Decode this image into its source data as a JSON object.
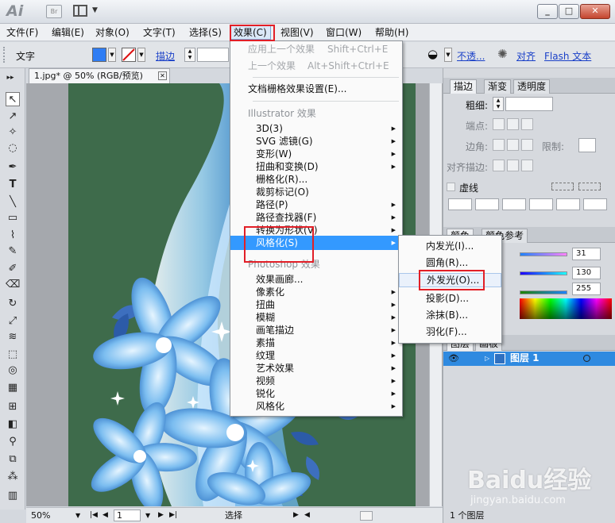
{
  "app": {
    "logo": "Ai",
    "bridge_label": "Br",
    "window_buttons": [
      "_",
      "□",
      "✕"
    ]
  },
  "menubar": {
    "items": [
      "文件(F)",
      "编辑(E)",
      "对象(O)",
      "文字(T)",
      "选择(S)",
      "效果(C)",
      "视图(V)",
      "窗口(W)",
      "帮助(H)"
    ],
    "active_index": 5
  },
  "controlbar": {
    "tool_label": "文字",
    "fill_color": "#2f7df4",
    "stroke_label": "描边",
    "opacity_label": "不透...",
    "align_label": "对齐",
    "flash_label": "Flash 文本"
  },
  "document": {
    "tab_title": "1.jpg* @ 50% (RGB/预览)",
    "artboard_color": "#3e6b4b"
  },
  "statusbar": {
    "zoom": "50%",
    "page": "1",
    "tool": "选择"
  },
  "effects_menu": {
    "apply_last": "应用上一个效果",
    "apply_last_shortcut": "Shift+Ctrl+E",
    "last": "上一个效果",
    "last_shortcut": "Alt+Shift+Ctrl+E",
    "raster_settings": "文档栅格效果设置(E)...",
    "illustrator_header": "Illustrator 效果",
    "illustrator_items": [
      "3D(3)",
      "SVG 滤镜(G)",
      "变形(W)",
      "扭曲和变换(D)",
      "栅格化(R)...",
      "裁剪标记(O)",
      "路径(P)",
      "路径查找器(F)",
      "转换为形状(V)",
      "风格化(S)"
    ],
    "photoshop_header": "Photoshop 效果",
    "photoshop_items": [
      "效果画廊...",
      "像素化",
      "扭曲",
      "模糊",
      "画笔描边",
      "素描",
      "纹理",
      "艺术效果",
      "视频",
      "锐化",
      "风格化"
    ]
  },
  "stylize_submenu": {
    "items": [
      "内发光(I)...",
      "圆角(R)...",
      "外发光(O)...",
      "投影(D)...",
      "涂抹(B)...",
      "羽化(F)..."
    ],
    "hover_index": 2
  },
  "panels": {
    "stroke_tabs": [
      "描边",
      "渐变",
      "透明度"
    ],
    "weight_label": "粗细:",
    "cap_label": "端点:",
    "corner_label": "边角:",
    "limit_label": "限制:",
    "align_stroke_label": "对齐描边:",
    "dashed_label": "虚线",
    "color_tabs": [
      "颜色",
      "颜色参考"
    ],
    "rgb_values": [
      "31",
      "130",
      "255"
    ],
    "layer_tabs": [
      "图层",
      "画板"
    ],
    "layer_name": "图层 1",
    "layer_count": "1 个图层"
  },
  "watermark": {
    "brand": "Baidu经验",
    "url": "jingyan.baidu.com"
  }
}
